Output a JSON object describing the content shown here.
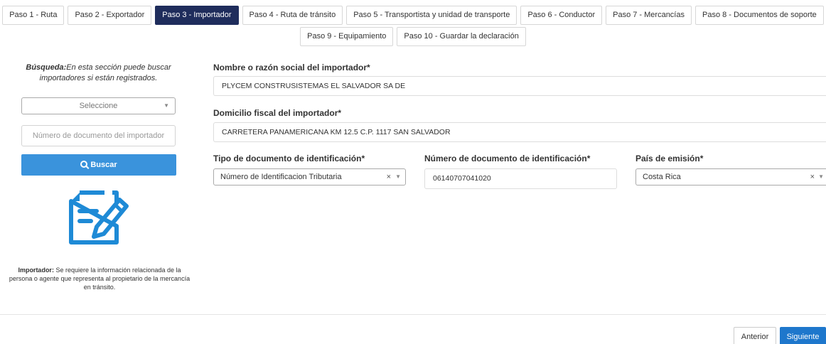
{
  "steps_row1": [
    {
      "label": "Paso 1 - Ruta",
      "active": false
    },
    {
      "label": "Paso 2 - Exportador",
      "active": false
    },
    {
      "label": "Paso 3 - Importador",
      "active": true
    },
    {
      "label": "Paso 4 - Ruta de tránsito",
      "active": false
    },
    {
      "label": "Paso 5 - Transportista y unidad de transporte",
      "active": false
    },
    {
      "label": "Paso 6 - Conductor",
      "active": false
    },
    {
      "label": "Paso 7 - Mercancías",
      "active": false
    },
    {
      "label": "Paso 8 - Documentos de soporte",
      "active": false
    }
  ],
  "steps_row2": [
    {
      "label": "Paso 9 - Equipamiento",
      "active": false
    },
    {
      "label": "Paso 10 - Guardar la declaración",
      "active": false
    }
  ],
  "search": {
    "help_bold": "Búsqueda:",
    "help_text": "En esta sección puede buscar importadores si están registrados.",
    "select_placeholder": "Seleccione",
    "doc_placeholder": "Número de documento del importador",
    "button_label": "Buscar"
  },
  "note": {
    "bold": "Importador:",
    "text": " Se requiere la información relacionada de la persona o agente que representa al propietario de la mercancía en tránsito."
  },
  "form": {
    "name_label": "Nombre o razón social del importador*",
    "name_value": "PLYCEM CONSTRUSISTEMAS EL SALVADOR SA DE",
    "address_label": "Domicilio fiscal del importador*",
    "address_value": "CARRETERA PANAMERICANA KM 12.5 C.P. 1117 SAN SALVADOR",
    "doc_type_label": "Tipo de documento de identificación*",
    "doc_type_value": "Número de Identificacion Tributaria",
    "doc_number_label": "Número de documento de identificación*",
    "doc_number_value": "06140707041020",
    "country_label": "País de emisión*",
    "country_value": "Costa Rica"
  },
  "nav": {
    "prev_label": "Anterior",
    "next_label": "Siguiente"
  },
  "colors": {
    "active_tab": "#1f2d5c",
    "search_button": "#3a93dc",
    "next_button": "#1e77cc",
    "icon_blue": "#1e8ad6"
  },
  "icons": {
    "search": "magnifier-icon",
    "document": "document-edit-icon"
  }
}
